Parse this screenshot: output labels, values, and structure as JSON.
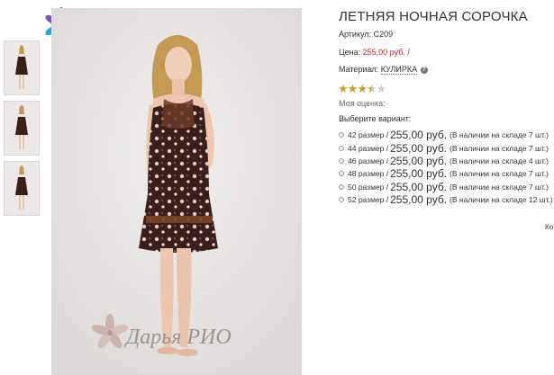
{
  "thumbnails": [
    {
      "alt": "thumb-1"
    },
    {
      "alt": "thumb-2"
    },
    {
      "alt": "thumb-3"
    }
  ],
  "watermark": {
    "text": "Дарья РИО"
  },
  "product": {
    "title": "ЛЕТНЯЯ НОЧНАЯ СОРОЧКА",
    "article_label": "Артикул:",
    "article_value": "С209",
    "price_label": "Цена:",
    "price_value": "255,00 руб.",
    "price_suffix": "/",
    "material_label": "Материал:",
    "material_value": "КУЛИРКА",
    "rating": 3.5,
    "rating_max": 5,
    "my_rating_label": "Моя оценка:",
    "choose_label": "Выберите вариант:"
  },
  "variants": [
    {
      "size": "42 размер",
      "sep": "/",
      "price": "255,00 руб.",
      "stock": "(В наличии на складе 7 шт.)"
    },
    {
      "size": "44 размер",
      "sep": "/",
      "price": "255,00 руб.",
      "stock": "(В наличии на складе 7 шт.)"
    },
    {
      "size": "46 размер",
      "sep": "/",
      "price": "255,00 руб.",
      "stock": "(В наличии на складе 4 шт.)"
    },
    {
      "size": "48 размер",
      "sep": "/",
      "price": "255,00 руб.",
      "stock": "(В наличии на складе 7 шт.)"
    },
    {
      "size": "50 размер",
      "sep": "/",
      "price": "255,00 руб.",
      "stock": "(В наличии на складе 7 шт.)"
    },
    {
      "size": "52 размер",
      "sep": "/",
      "price": "255,00 руб.",
      "stock": "(В наличии на складе 12 шт.)"
    }
  ],
  "cut_text": "Ко",
  "colors": {
    "price_red": "#c0272d",
    "star_gold": "#c9a21a",
    "dress_brown": "#3a1f1c"
  }
}
